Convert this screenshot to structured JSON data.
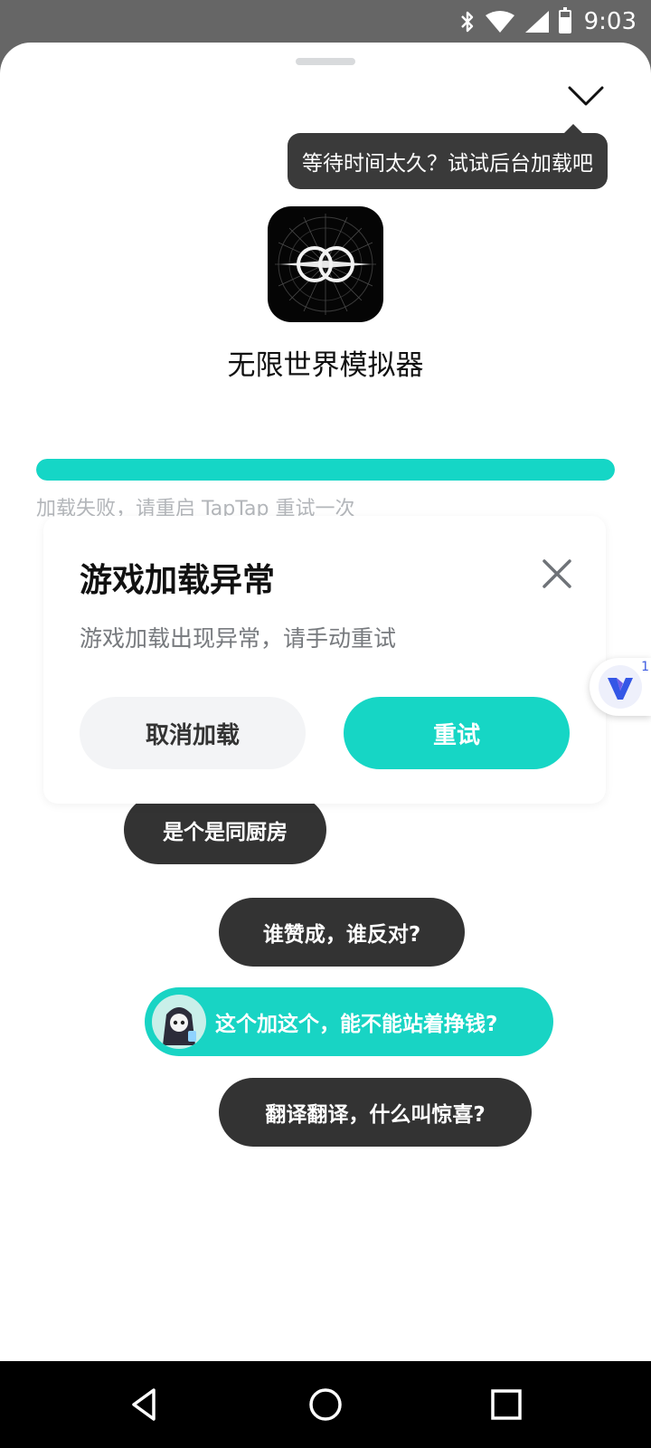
{
  "status_bar": {
    "time": "9:03",
    "icons": [
      "bluetooth-icon",
      "wifi-icon",
      "signal-icon",
      "battery-icon"
    ],
    "battery_level": 0.75
  },
  "sheet": {
    "tooltip": "等待时间太久？试试后台加载吧",
    "app_name": "无限世界模拟器",
    "progress": 1.0,
    "load_status": "加载失败，请重启 TapTap 重试一次"
  },
  "bubbles": [
    {
      "text": "是个是同厨房"
    },
    {
      "text": "谁赞成，谁反对?"
    },
    {
      "text": "这个加这个，能不能站着挣钱?"
    },
    {
      "text": "翻译翻译，什么叫惊喜?"
    }
  ],
  "dialog": {
    "title": "游戏加载异常",
    "message": "游戏加载出现异常，请手动重试",
    "cancel_label": "取消加载",
    "retry_label": "重试"
  },
  "float_badge": {
    "count": "1"
  },
  "colors": {
    "accent": "#16d6c5",
    "dark_bubble": "#333333",
    "status_bar_bg": "#666666"
  }
}
